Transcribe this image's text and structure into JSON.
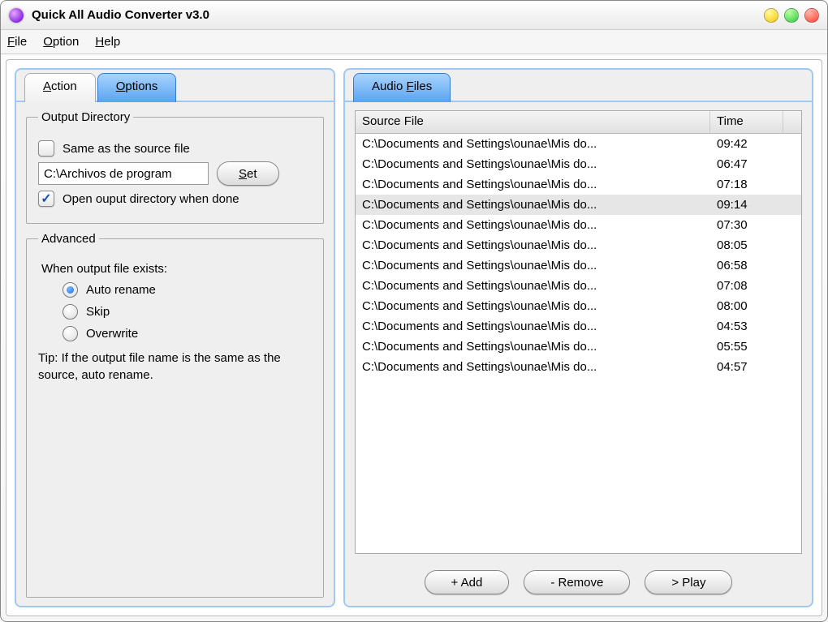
{
  "window": {
    "title": "Quick All Audio Converter v3.0"
  },
  "menu": {
    "file": "File",
    "option": "Option",
    "help": "Help"
  },
  "leftPanel": {
    "tabs": {
      "action": "Action",
      "options": "Options"
    },
    "outputDir": {
      "legend": "Output Directory",
      "sameAsSource": "Same as the source file",
      "path": "C:\\Archivos de program",
      "setBtn": "Set",
      "openWhenDone": "Open ouput directory when done"
    },
    "advanced": {
      "legend": "Advanced",
      "whenExists": "When output file exists:",
      "autoRename": "Auto rename",
      "skip": "Skip",
      "overwrite": "Overwrite",
      "tip": "Tip: If the output file name is the same as the source, auto rename."
    }
  },
  "rightPanel": {
    "tab": "Audio Files",
    "cols": {
      "src": "Source File",
      "time": "Time"
    },
    "rows": [
      {
        "file": "C:\\Documents and Settings\\ounae\\Mis do...",
        "time": "09:42",
        "sel": false
      },
      {
        "file": "C:\\Documents and Settings\\ounae\\Mis do...",
        "time": "06:47",
        "sel": false
      },
      {
        "file": "C:\\Documents and Settings\\ounae\\Mis do...",
        "time": "07:18",
        "sel": false
      },
      {
        "file": "C:\\Documents and Settings\\ounae\\Mis do...",
        "time": "09:14",
        "sel": true
      },
      {
        "file": "C:\\Documents and Settings\\ounae\\Mis do...",
        "time": "07:30",
        "sel": false
      },
      {
        "file": "C:\\Documents and Settings\\ounae\\Mis do...",
        "time": "08:05",
        "sel": false
      },
      {
        "file": "C:\\Documents and Settings\\ounae\\Mis do...",
        "time": "06:58",
        "sel": false
      },
      {
        "file": "C:\\Documents and Settings\\ounae\\Mis do...",
        "time": "07:08",
        "sel": false
      },
      {
        "file": "C:\\Documents and Settings\\ounae\\Mis do...",
        "time": "08:00",
        "sel": false
      },
      {
        "file": "C:\\Documents and Settings\\ounae\\Mis do...",
        "time": "04:53",
        "sel": false
      },
      {
        "file": "C:\\Documents and Settings\\ounae\\Mis do...",
        "time": "05:55",
        "sel": false
      },
      {
        "file": "C:\\Documents and Settings\\ounae\\Mis do...",
        "time": "04:57",
        "sel": false
      }
    ],
    "buttons": {
      "add": "+ Add",
      "remove": "- Remove",
      "play": "> Play"
    }
  }
}
